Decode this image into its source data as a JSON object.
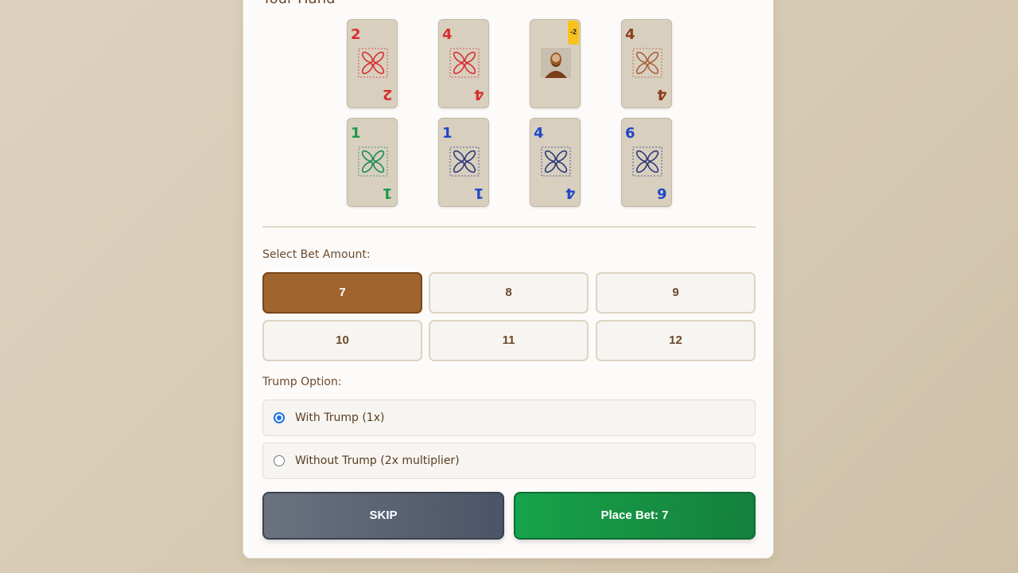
{
  "hand": {
    "title": "Your Hand",
    "cards": [
      {
        "rank": "2",
        "suit": "red"
      },
      {
        "rank": "4",
        "suit": "red"
      },
      {
        "rank": "",
        "suit": "face",
        "badge": "-2",
        "icon": "portrait-face-card"
      },
      {
        "rank": "4",
        "suit": "brown"
      },
      {
        "rank": "1",
        "suit": "green"
      },
      {
        "rank": "1",
        "suit": "blue"
      },
      {
        "rank": "4",
        "suit": "blue"
      },
      {
        "rank": "6",
        "suit": "blue"
      }
    ]
  },
  "bet": {
    "label": "Select Bet Amount:",
    "options": [
      "7",
      "8",
      "9",
      "10",
      "11",
      "12"
    ],
    "selected": "7"
  },
  "trump": {
    "label": "Trump Option:",
    "options": [
      {
        "label": "With Trump (1x)",
        "checked": true
      },
      {
        "label": "Without Trump (2x multiplier)",
        "checked": false
      }
    ]
  },
  "actions": {
    "skip_label": "SKIP",
    "place_label": "Place Bet: 7"
  },
  "colors": {
    "red": "#d62f2f",
    "brown": "#8b3d1a",
    "green": "#1a9a4a",
    "blue": "#1f47c7",
    "selected_bet": "#a0652e",
    "place_button": "#16a34a",
    "skip_button": "#4b5567"
  }
}
